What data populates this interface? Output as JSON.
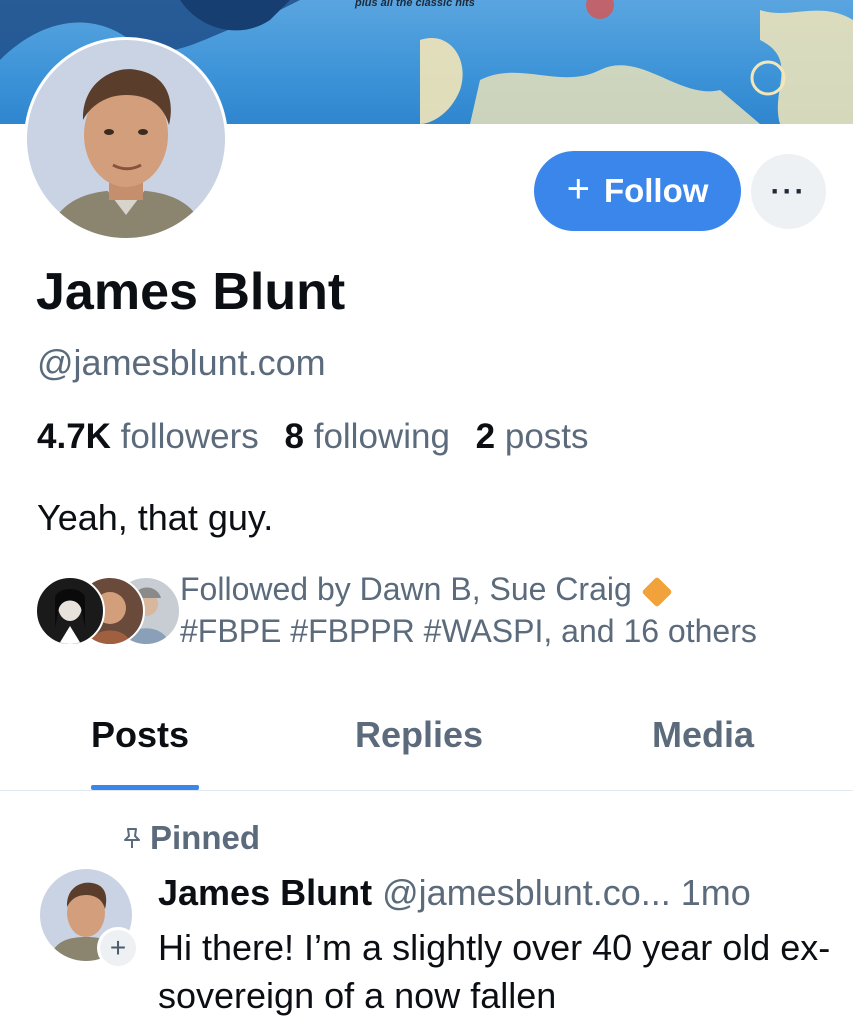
{
  "banner": {
    "caption": "plus all the classic hits"
  },
  "profile": {
    "name": "James Blunt",
    "handle": "@jamesblunt.com",
    "stats": {
      "followers_count": "4.7K",
      "followers_label": "followers",
      "following_count": "8",
      "following_label": "following",
      "posts_count": "2",
      "posts_label": "posts"
    },
    "bio": "Yeah, that guy.",
    "followed_by_line1": "Followed by Dawn B, Sue Craig",
    "followed_by_line2": "#FBPE #FBPPR #WASPI, and 16 others"
  },
  "actions": {
    "follow_icon": "+",
    "follow_label": "Follow",
    "more_label": "···"
  },
  "tabs": [
    {
      "label": "Posts",
      "active": true
    },
    {
      "label": "Replies",
      "active": false
    },
    {
      "label": "Media",
      "active": false
    }
  ],
  "post": {
    "pinned_label": "Pinned",
    "author_name": "James Blunt",
    "author_handle": "@jamesblunt.co...",
    "time": "1mo",
    "text": "Hi there! I’m a slightly over 40 year old ex-sovereign of a now fallen"
  },
  "colors": {
    "accent": "#3a86ea",
    "muted": "#5b6b7c",
    "badge": "#f2a23a"
  }
}
